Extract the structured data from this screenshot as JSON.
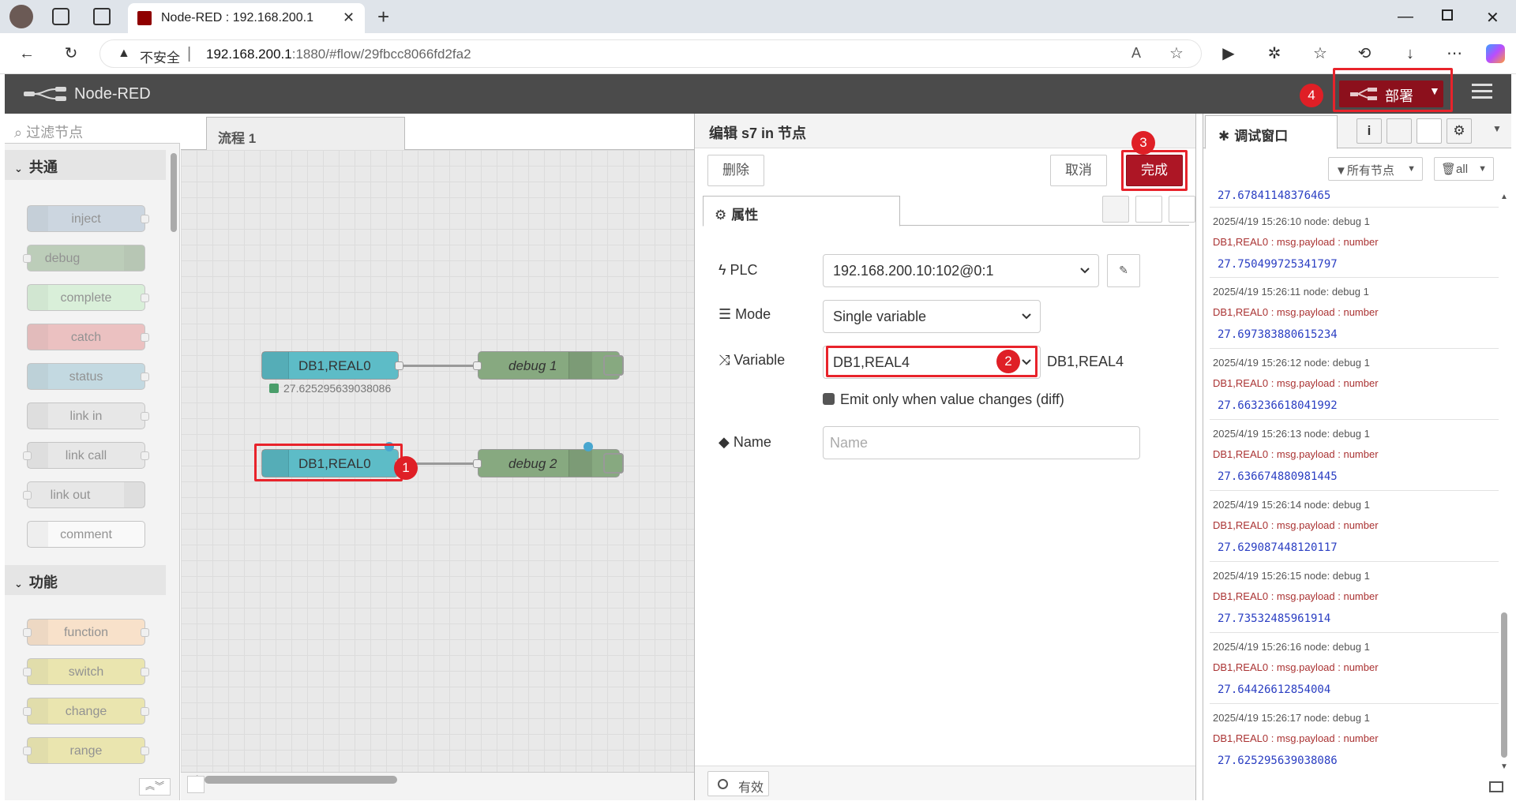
{
  "browser": {
    "tab_title": "Node-RED : 192.168.200.1",
    "url_insecure": "不安全",
    "url_host": "192.168.200.1",
    "url_rest": ":1880/#flow/29fbcc8066fd2fa2"
  },
  "header": {
    "app_name": "Node-RED",
    "deploy_label": "部署"
  },
  "palette": {
    "filter_placeholder": "过滤节点",
    "categories": [
      {
        "name": "共通"
      },
      {
        "name": "功能"
      }
    ],
    "nodes": [
      {
        "label": "inject",
        "color": "#a6bbcf"
      },
      {
        "label": "debug",
        "color": "#87a980"
      },
      {
        "label": "complete",
        "color": "#c0edc0"
      },
      {
        "label": "catch",
        "color": "#e49191"
      },
      {
        "label": "status",
        "color": "#94c1d0"
      },
      {
        "label": "link in",
        "color": "#dddddd"
      },
      {
        "label": "link call",
        "color": "#dddddd"
      },
      {
        "label": "link out",
        "color": "#dddddd"
      },
      {
        "label": "comment",
        "color": "#ffffff"
      },
      {
        "label": "function",
        "color": "#fdd0a2"
      },
      {
        "label": "switch",
        "color": "#e2d96e"
      },
      {
        "label": "change",
        "color": "#e2d96e"
      },
      {
        "label": "range",
        "color": "#e2d96e"
      }
    ]
  },
  "workspace": {
    "tab_label": "流程 1",
    "nodes": [
      {
        "label": "DB1,REAL0",
        "status": "27.625295639038086"
      },
      {
        "label": "debug 1"
      },
      {
        "label": "DB1,REAL0"
      },
      {
        "label": "debug 2"
      }
    ]
  },
  "editor": {
    "title": "编辑 s7 in 节点",
    "delete_label": "删除",
    "cancel_label": "取消",
    "done_label": "完成",
    "properties_tab": "属性",
    "plc_label": "PLC",
    "plc_value": "192.168.200.10:102@0:1",
    "mode_label": "Mode",
    "mode_value": "Single variable",
    "variable_label": "Variable",
    "variable_value": "DB1,REAL4",
    "variable_hint": "DB1,REAL4",
    "diff_label": "Emit only when value changes (diff)",
    "name_label": "Name",
    "name_placeholder": "Name",
    "enabled_label": "有效"
  },
  "sidebar": {
    "tab_label": "调试窗口",
    "filter_nodes": "所有节点",
    "filter_clear": "all",
    "top_value": "27.67841148376465",
    "messages": [
      {
        "meta": "2025/4/19 15:26:10   node: debug 1",
        "topic": "DB1,REAL0 : msg.payload : number",
        "value": "27.750499725341797"
      },
      {
        "meta": "2025/4/19 15:26:11   node: debug 1",
        "topic": "DB1,REAL0 : msg.payload : number",
        "value": "27.697383880615234"
      },
      {
        "meta": "2025/4/19 15:26:12   node: debug 1",
        "topic": "DB1,REAL0 : msg.payload : number",
        "value": "27.663236618041992"
      },
      {
        "meta": "2025/4/19 15:26:13   node: debug 1",
        "topic": "DB1,REAL0 : msg.payload : number",
        "value": "27.636674880981445"
      },
      {
        "meta": "2025/4/19 15:26:14   node: debug 1",
        "topic": "DB1,REAL0 : msg.payload : number",
        "value": "27.629087448120117"
      },
      {
        "meta": "2025/4/19 15:26:15   node: debug 1",
        "topic": "DB1,REAL0 : msg.payload : number",
        "value": "27.73532485961914"
      },
      {
        "meta": "2025/4/19 15:26:16   node: debug 1",
        "topic": "DB1,REAL0 : msg.payload : number",
        "value": "27.64426612854004"
      },
      {
        "meta": "2025/4/19 15:26:17   node: debug 1",
        "topic": "DB1,REAL0 : msg.payload : number",
        "value": "27.625295639038086"
      }
    ]
  },
  "annotations": {
    "badge_1": "1",
    "badge_2": "2",
    "badge_3": "3",
    "badge_4": "4"
  },
  "colors": {
    "accent": "#ad1625",
    "annotation_red": "#e8232b",
    "debug_value": "#2a3ec2"
  }
}
